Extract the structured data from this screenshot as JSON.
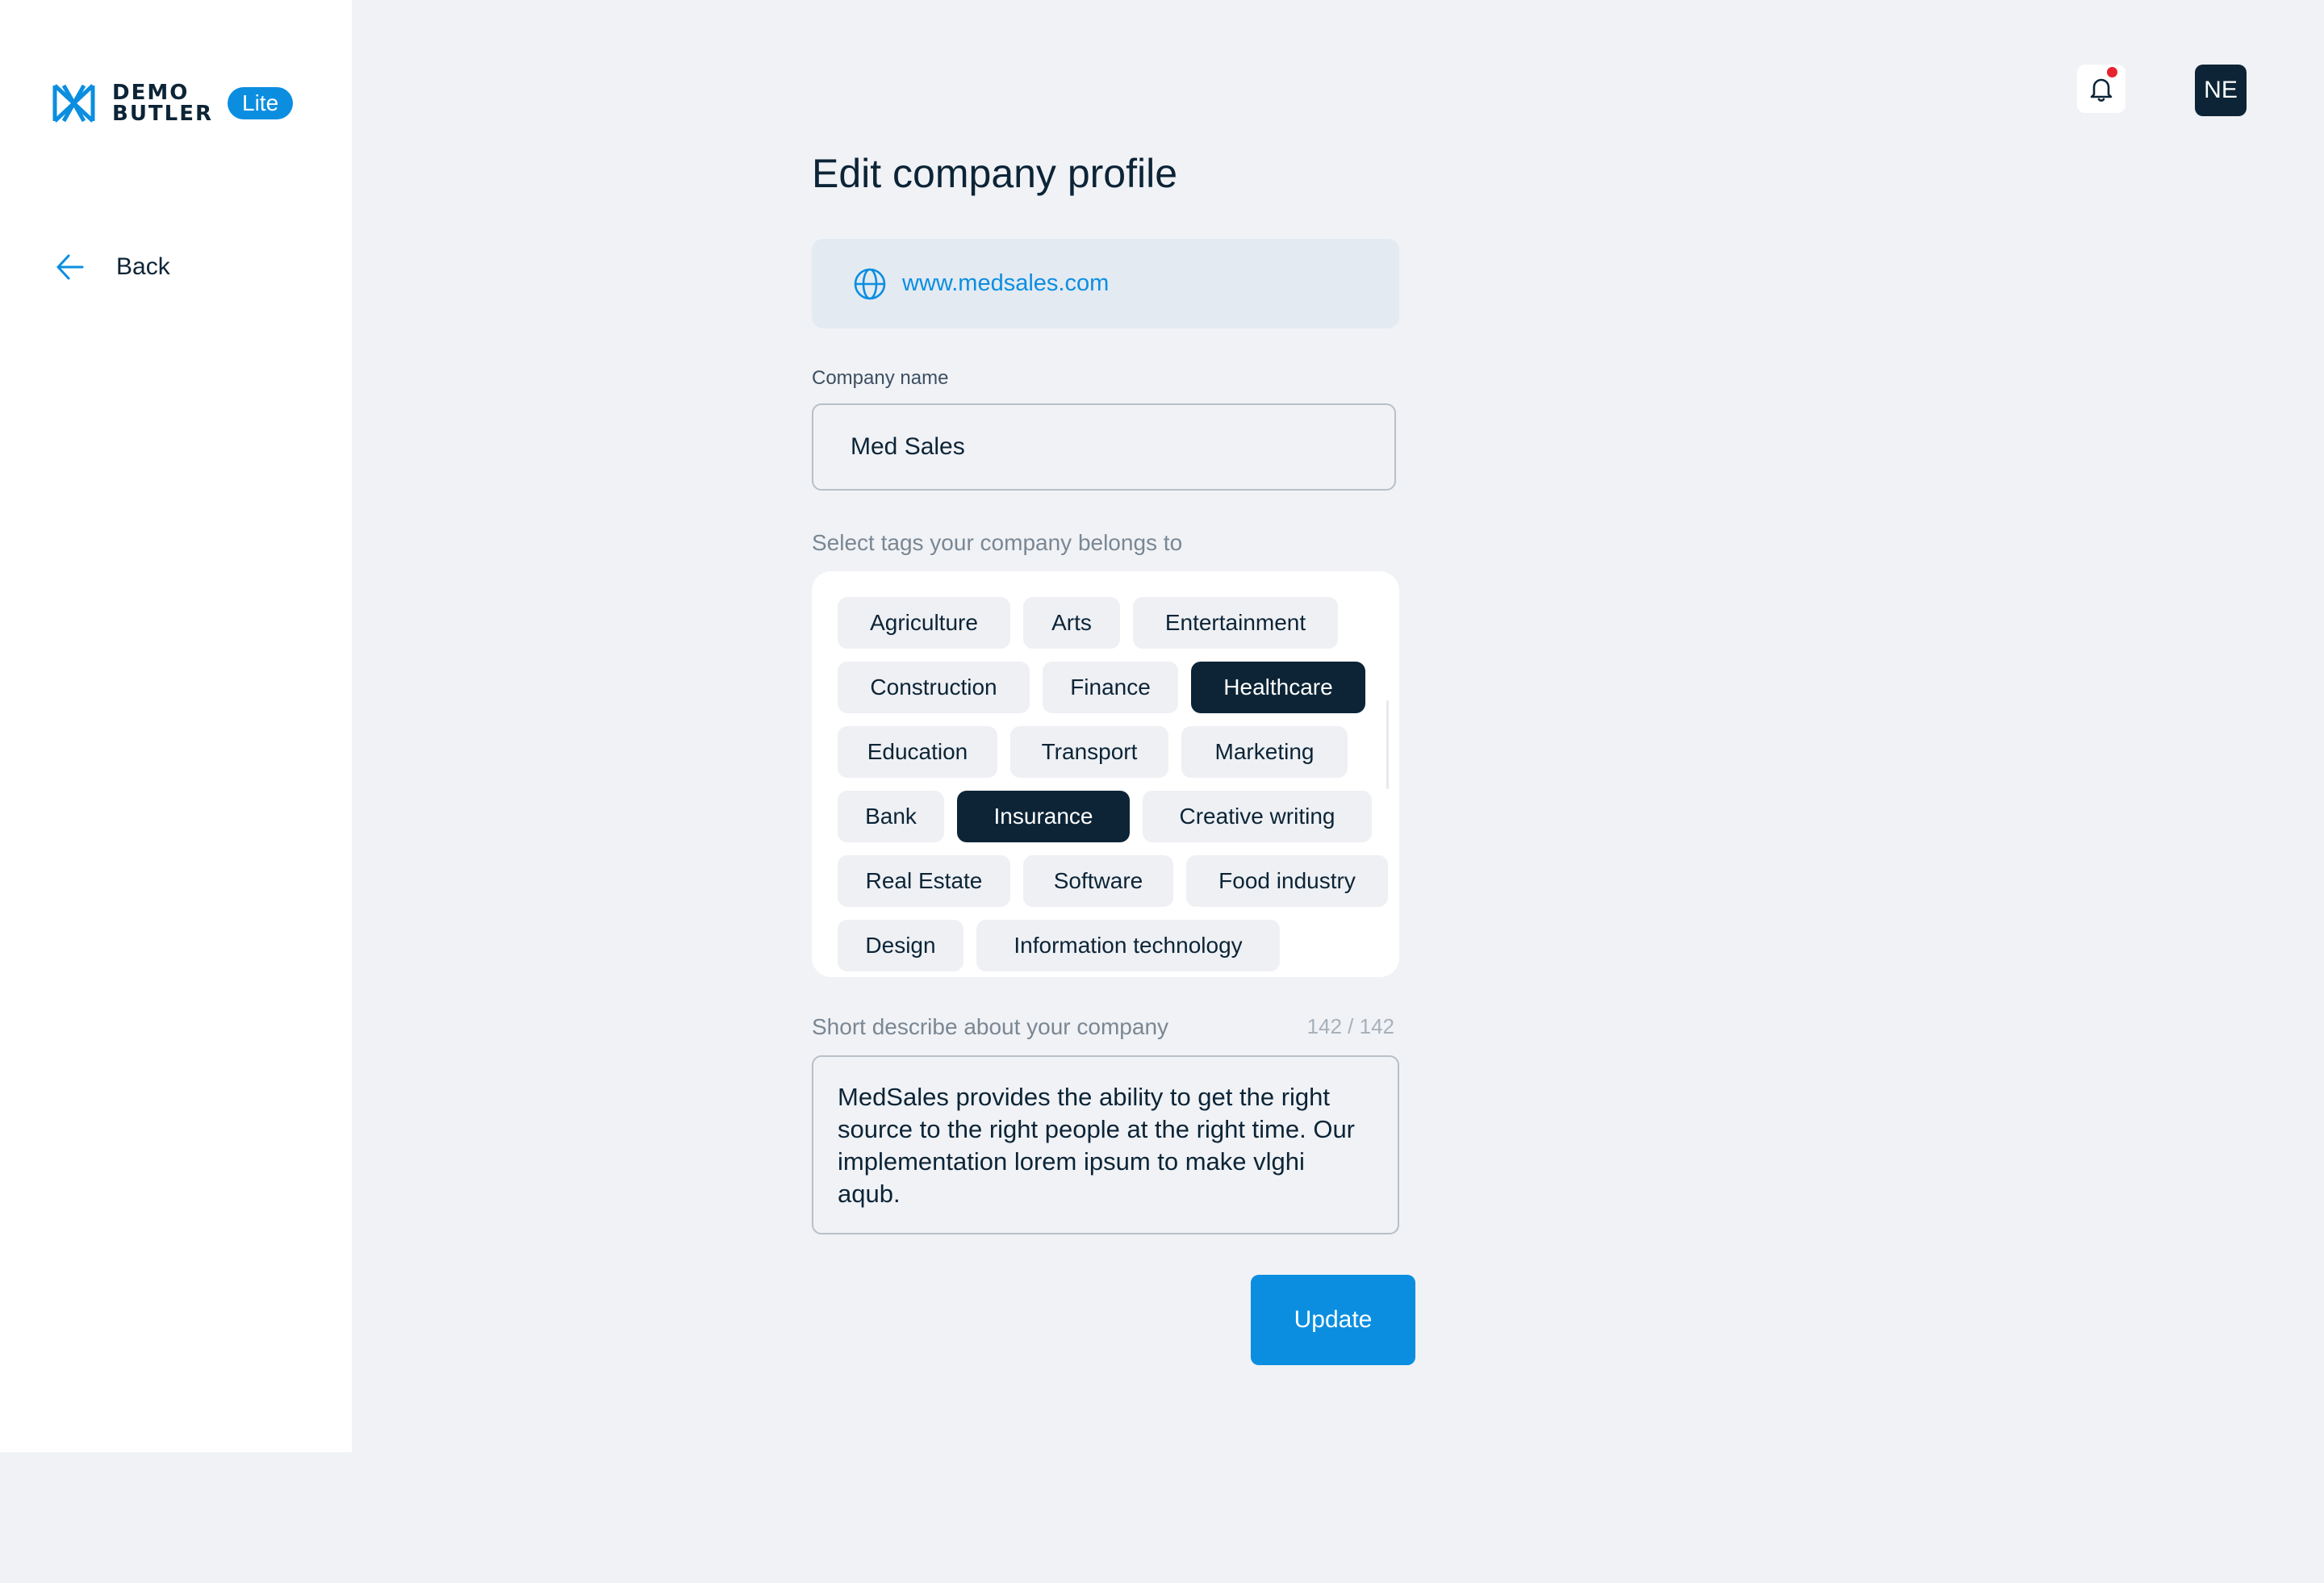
{
  "brand": {
    "name_line1": "DEMO",
    "name_line2": "BUTLER",
    "badge": "Lite",
    "accent_color": "#0b8ee0",
    "dark_color": "#0c2436"
  },
  "sidebar": {
    "back_label": "Back",
    "back_icon": "arrow-left-icon"
  },
  "header": {
    "notification_icon": "bell-icon",
    "has_unread_notifications": true,
    "avatar_initials": "NE"
  },
  "form": {
    "title": "Edit company profile",
    "website": {
      "icon": "globe-icon",
      "url": "www.medsales.com"
    },
    "company_name": {
      "label": "Company name",
      "value": "Med Sales"
    },
    "tags": {
      "label": "Select tags your company belongs to",
      "items": [
        {
          "label": "Agriculture",
          "selected": false
        },
        {
          "label": "Arts",
          "selected": false
        },
        {
          "label": "Entertainment",
          "selected": false
        },
        {
          "label": "Construction",
          "selected": false
        },
        {
          "label": "Finance",
          "selected": false
        },
        {
          "label": "Healthcare",
          "selected": true
        },
        {
          "label": "Education",
          "selected": false
        },
        {
          "label": "Transport",
          "selected": false
        },
        {
          "label": "Marketing",
          "selected": false
        },
        {
          "label": "Bank",
          "selected": false
        },
        {
          "label": "Insurance",
          "selected": true
        },
        {
          "label": "Creative writing",
          "selected": false
        },
        {
          "label": "Real Estate",
          "selected": false
        },
        {
          "label": "Software",
          "selected": false
        },
        {
          "label": "Food industry",
          "selected": false
        },
        {
          "label": "Design",
          "selected": false
        },
        {
          "label": "Information technology",
          "selected": false
        }
      ]
    },
    "description": {
      "label": "Short describe about your company",
      "char_count": "142 / 142",
      "value": "MedSales provides the ability to get the right source to the right people at the right time. Our implementation lorem ipsum to make vlghi aqub."
    },
    "submit_label": "Update"
  }
}
